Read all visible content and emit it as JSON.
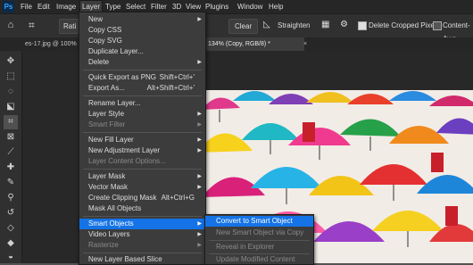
{
  "menubar": {
    "logo": "Ps",
    "items": [
      "File",
      "Edit",
      "Image",
      "Layer",
      "Type",
      "Select",
      "Filter",
      "3D",
      "View",
      "Plugins",
      "Window",
      "Help"
    ]
  },
  "options": {
    "ratio_label": "Rati",
    "clear": "Clear",
    "straighten": "Straighten",
    "delete_cropped": "Delete Cropped Pixels",
    "content_aware": "Content-Awa"
  },
  "tabs": {
    "left": "es-17.jpg @ 100%",
    "active": "134% (Copy, RGB/8) *",
    "close_glyph": "×"
  },
  "layer_menu": {
    "items": [
      {
        "label": "New",
        "shortcut": "",
        "submenu": true,
        "disabled": false
      },
      {
        "label": "Copy CSS",
        "shortcut": "",
        "submenu": false,
        "disabled": false
      },
      {
        "label": "Copy SVG",
        "shortcut": "",
        "submenu": false,
        "disabled": false
      },
      {
        "label": "Duplicate Layer...",
        "shortcut": "",
        "submenu": false,
        "disabled": false
      },
      {
        "label": "Delete",
        "shortcut": "",
        "submenu": true,
        "disabled": false
      },
      {
        "label": "Quick Export as PNG",
        "shortcut": "Shift+Ctrl+'",
        "submenu": false,
        "disabled": false
      },
      {
        "label": "Export As...",
        "shortcut": "Alt+Shift+Ctrl+'",
        "submenu": false,
        "disabled": false
      },
      {
        "label": "Rename Layer...",
        "shortcut": "",
        "submenu": false,
        "disabled": false
      },
      {
        "label": "Layer Style",
        "shortcut": "",
        "submenu": true,
        "disabled": false
      },
      {
        "label": "Smart Filter",
        "shortcut": "",
        "submenu": true,
        "disabled": true
      },
      {
        "label": "New Fill Layer",
        "shortcut": "",
        "submenu": true,
        "disabled": false
      },
      {
        "label": "New Adjustment Layer",
        "shortcut": "",
        "submenu": true,
        "disabled": false
      },
      {
        "label": "Layer Content Options...",
        "shortcut": "",
        "submenu": false,
        "disabled": true
      },
      {
        "label": "Layer Mask",
        "shortcut": "",
        "submenu": true,
        "disabled": false
      },
      {
        "label": "Vector Mask",
        "shortcut": "",
        "submenu": true,
        "disabled": false
      },
      {
        "label": "Create Clipping Mask",
        "shortcut": "Alt+Ctrl+G",
        "submenu": false,
        "disabled": false
      },
      {
        "label": "Mask All Objects",
        "shortcut": "",
        "submenu": false,
        "disabled": false
      },
      {
        "label": "Smart Objects",
        "shortcut": "",
        "submenu": true,
        "disabled": false,
        "highlighted": true
      },
      {
        "label": "Video Layers",
        "shortcut": "",
        "submenu": true,
        "disabled": false
      },
      {
        "label": "Rasterize",
        "shortcut": "",
        "submenu": true,
        "disabled": true
      },
      {
        "label": "New Layer Based Slice",
        "shortcut": "",
        "submenu": false,
        "disabled": false
      }
    ]
  },
  "smart_objects_menu": {
    "items": [
      {
        "label": "Convert to Smart Object",
        "disabled": false,
        "highlighted": true
      },
      {
        "label": "New Smart Object via Copy",
        "disabled": true
      },
      {
        "label": "Reveal in Explorer",
        "disabled": true
      },
      {
        "label": "Update Modified Content",
        "disabled": true
      }
    ]
  },
  "toolbar": {
    "icons": [
      "move-icon",
      "marquee-icon",
      "lasso-icon",
      "object-select-icon",
      "crop-icon",
      "frame-icon",
      "eyedropper-icon",
      "healing-brush-icon",
      "brush-icon",
      "clone-stamp-icon",
      "history-brush-icon",
      "eraser-icon",
      "gradient-icon",
      "blur-icon"
    ]
  },
  "colors": {
    "accent": "#1473e6",
    "menu_bg": "#3c3c3c",
    "app_bg": "#262626",
    "logo_blue": "#31a8ff"
  }
}
